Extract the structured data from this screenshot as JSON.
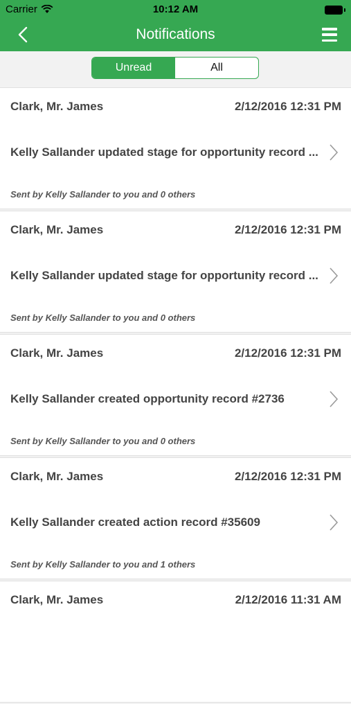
{
  "status_bar": {
    "carrier": "Carrier",
    "time": "10:12 AM"
  },
  "nav": {
    "title": "Notifications",
    "back_icon": "back-chevron-icon",
    "menu_icon": "hamburger-menu-icon"
  },
  "colors": {
    "accent": "#36a852",
    "text": "#444444"
  },
  "filter": {
    "options": [
      "Unread",
      "All"
    ],
    "selected": "Unread"
  },
  "notifications": [
    {
      "name": "Clark, Mr. James",
      "date": "2/12/2016 12:31 PM",
      "message": "Kelly Sallander updated stage for opportunity record ...",
      "sent": "Sent by Kelly Sallander to you and 0 others"
    },
    {
      "name": "Clark, Mr. James",
      "date": "2/12/2016 12:31 PM",
      "message": "Kelly Sallander updated stage for opportunity record ...",
      "sent": "Sent by Kelly Sallander to you and 0 others"
    },
    {
      "name": "Clark, Mr. James",
      "date": "2/12/2016 12:31 PM",
      "message": "Kelly Sallander created opportunity record #2736",
      "sent": "Sent by Kelly Sallander to you and 0 others"
    },
    {
      "name": "Clark, Mr. James",
      "date": "2/12/2016 12:31 PM",
      "message": "Kelly Sallander created action record #35609",
      "sent": "Sent by Kelly Sallander to you and 1 others"
    },
    {
      "name": "Clark, Mr. James",
      "date": "2/12/2016 11:31 AM",
      "message": "",
      "sent": ""
    }
  ]
}
